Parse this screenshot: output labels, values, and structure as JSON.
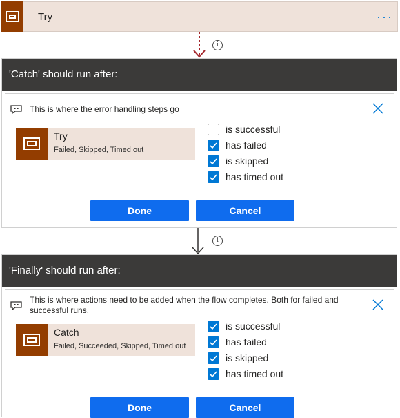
{
  "try_action": {
    "title": "Try",
    "more_label": "···"
  },
  "connectors": [
    {
      "info": "i"
    },
    {
      "info": "i"
    }
  ],
  "panels": [
    {
      "header": "'Catch' should run after:",
      "message": "This is where the error handling steps go",
      "card": {
        "name": "Try",
        "status": "Failed, Skipped, Timed out"
      },
      "options": [
        {
          "label": "is successful",
          "checked": false
        },
        {
          "label": "has failed",
          "checked": true
        },
        {
          "label": "is skipped",
          "checked": true
        },
        {
          "label": "has timed out",
          "checked": true
        }
      ],
      "done_label": "Done",
      "cancel_label": "Cancel"
    },
    {
      "header": "'Finally' should run after:",
      "message": "This is where actions need to be added when the flow completes. Both for failed and successful runs.",
      "card": {
        "name": "Catch",
        "status": "Failed, Succeeded, Skipped, Timed out"
      },
      "options": [
        {
          "label": "is successful",
          "checked": true
        },
        {
          "label": "has failed",
          "checked": true
        },
        {
          "label": "is skipped",
          "checked": true
        },
        {
          "label": "has timed out",
          "checked": true
        }
      ],
      "done_label": "Done",
      "cancel_label": "Cancel"
    }
  ],
  "colors": {
    "scope_brown": "#933d00",
    "card_bg": "#efe2da",
    "header_bg": "#3b3a39",
    "accent_blue": "#0078d4",
    "button_blue": "#0f6cee",
    "failure_arrow": "#a4262c"
  }
}
